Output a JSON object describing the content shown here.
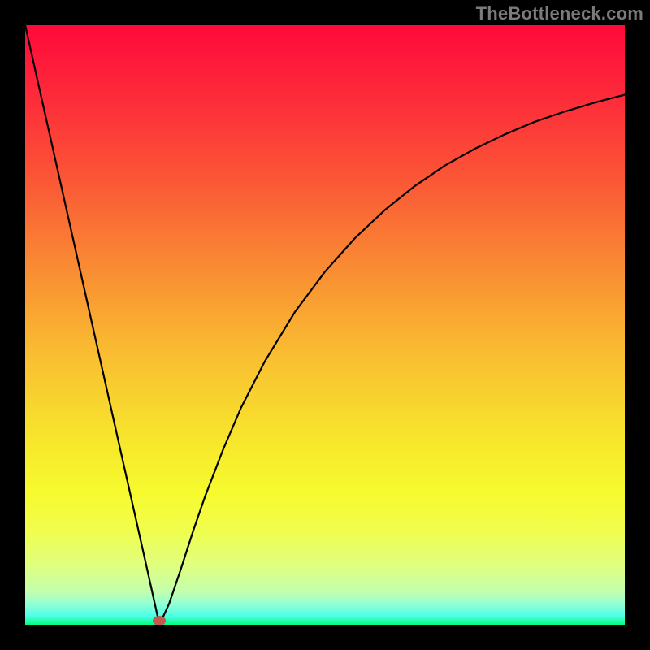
{
  "watermark": "TheBottleneck.com",
  "colors": {
    "background": "#000000",
    "marker": "#c35a4b",
    "gradient_stops": [
      {
        "offset": 0.0,
        "color": "#fe093a"
      },
      {
        "offset": 0.12,
        "color": "#fd2b3a"
      },
      {
        "offset": 0.25,
        "color": "#fb5436"
      },
      {
        "offset": 0.4,
        "color": "#f98a33"
      },
      {
        "offset": 0.55,
        "color": "#f9be31"
      },
      {
        "offset": 0.7,
        "color": "#f7e82c"
      },
      {
        "offset": 0.78,
        "color": "#f6fb2e"
      },
      {
        "offset": 0.84,
        "color": "#f1fd4b"
      },
      {
        "offset": 0.9,
        "color": "#e0ff7e"
      },
      {
        "offset": 0.945,
        "color": "#c3ffae"
      },
      {
        "offset": 0.965,
        "color": "#93ffd3"
      },
      {
        "offset": 0.985,
        "color": "#4effea"
      },
      {
        "offset": 1.0,
        "color": "#00ff7b"
      }
    ]
  },
  "chart_data": {
    "type": "line",
    "title": "",
    "xlabel": "",
    "ylabel": "",
    "xlim": [
      0,
      100
    ],
    "ylim": [
      0,
      100
    ],
    "grid": false,
    "legend": null,
    "marker": {
      "x": 22.4,
      "y": 0.7
    },
    "series": [
      {
        "name": "curve",
        "points": [
          {
            "x": 0.0,
            "y": 100.0
          },
          {
            "x": 5.0,
            "y": 77.7
          },
          {
            "x": 10.0,
            "y": 55.4
          },
          {
            "x": 15.0,
            "y": 33.1
          },
          {
            "x": 20.0,
            "y": 10.8
          },
          {
            "x": 22.4,
            "y": 0.0
          },
          {
            "x": 24.0,
            "y": 3.5
          },
          {
            "x": 26.0,
            "y": 9.4
          },
          {
            "x": 28.0,
            "y": 15.6
          },
          {
            "x": 30.0,
            "y": 21.4
          },
          {
            "x": 33.0,
            "y": 29.2
          },
          {
            "x": 36.0,
            "y": 36.2
          },
          {
            "x": 40.0,
            "y": 44.0
          },
          {
            "x": 45.0,
            "y": 52.2
          },
          {
            "x": 50.0,
            "y": 58.9
          },
          {
            "x": 55.0,
            "y": 64.5
          },
          {
            "x": 60.0,
            "y": 69.2
          },
          {
            "x": 65.0,
            "y": 73.2
          },
          {
            "x": 70.0,
            "y": 76.6
          },
          {
            "x": 75.0,
            "y": 79.4
          },
          {
            "x": 80.0,
            "y": 81.8
          },
          {
            "x": 85.0,
            "y": 83.9
          },
          {
            "x": 90.0,
            "y": 85.6
          },
          {
            "x": 95.0,
            "y": 87.1
          },
          {
            "x": 100.0,
            "y": 88.4
          }
        ]
      }
    ]
  }
}
